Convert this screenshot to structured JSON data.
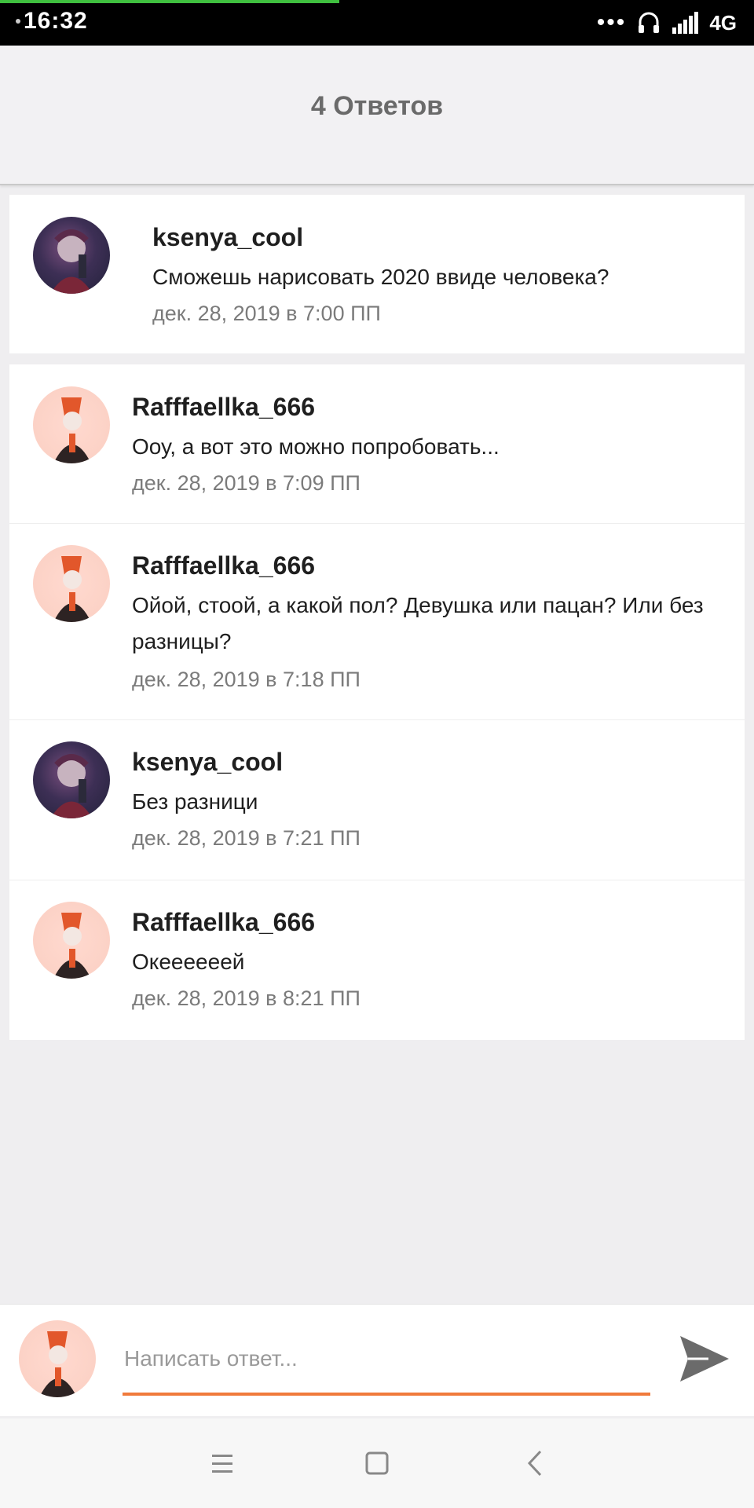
{
  "status_bar": {
    "time": "16:32",
    "network": "4G",
    "icons": [
      "more-dots-icon",
      "headphones-icon",
      "signal-icon",
      "network-4g-icon"
    ]
  },
  "header": {
    "title": "4 Ответов"
  },
  "post": {
    "author": "ksenya_cool",
    "text": "Сможешь нарисовать 2020 ввиде человека?",
    "date": "дек. 28, 2019 в 7:00 ПП"
  },
  "replies": [
    {
      "author": "Rafffaellka_666",
      "text": "Ооу, а вот это можно попробовать...",
      "date": "дек. 28, 2019 в 7:09 ПП"
    },
    {
      "author": "Rafffaellka_666",
      "text": "Ойой, стоой, а какой пол? Девушка или пацан? Или без разницы?",
      "date": "дек. 28, 2019 в 7:18 ПП"
    },
    {
      "author": "ksenya_cool",
      "text": "Без разници",
      "date": "дек. 28, 2019 в 7:21 ПП"
    },
    {
      "author": "Rafffaellka_666",
      "text": "Океееееей",
      "date": "дек. 28, 2019 в 8:21 ПП"
    }
  ],
  "composer": {
    "placeholder": "Написать ответ...",
    "accent_color": "#f07a3b",
    "send_icon": "send-icon"
  },
  "navbar": {
    "icons": [
      "menu-icon",
      "home-icon",
      "back-icon"
    ]
  }
}
